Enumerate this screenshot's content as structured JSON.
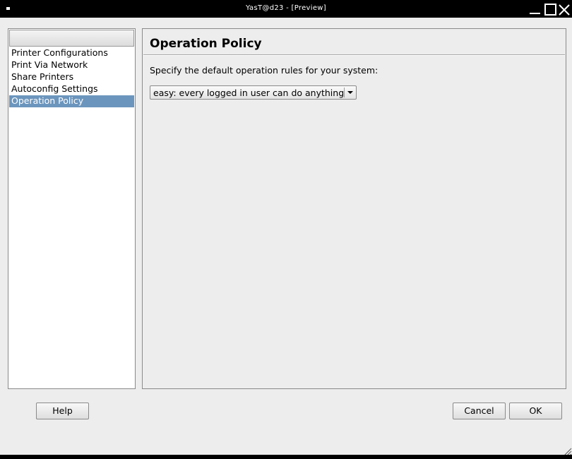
{
  "window": {
    "title": "YasT@d23 - [Preview]"
  },
  "tree": {
    "items": [
      {
        "label": "Printer Configurations",
        "selected": false
      },
      {
        "label": "Print Via Network",
        "selected": false
      },
      {
        "label": "Share Printers",
        "selected": false
      },
      {
        "label": "Autoconfig Settings",
        "selected": false
      },
      {
        "label": "Operation Policy",
        "selected": true
      }
    ],
    "selection_color": "#6b95bd"
  },
  "main": {
    "title": "Operation Policy",
    "description": "Specify the default operation rules for your system:",
    "policy_combo": {
      "selected": "easy: every logged in user can do anything"
    }
  },
  "buttons": {
    "help": "Help",
    "cancel": "Cancel",
    "ok": "OK"
  }
}
